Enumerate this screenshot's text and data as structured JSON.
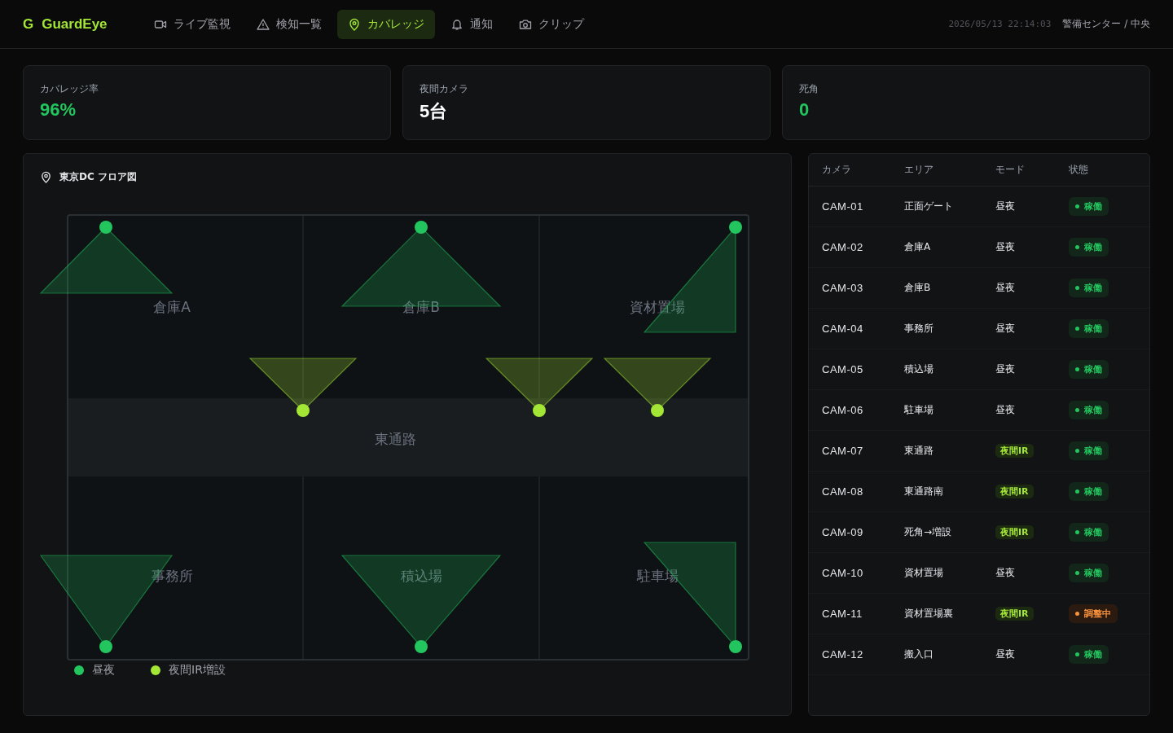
{
  "brand": {
    "mark": "G",
    "name": "GuardEye"
  },
  "nav": [
    {
      "label": "ライブ監視",
      "selected": false
    },
    {
      "label": "検知一覧",
      "selected": false
    },
    {
      "label": "カバレッジ",
      "selected": true
    },
    {
      "label": "通知",
      "selected": false
    },
    {
      "label": "クリップ",
      "selected": false
    }
  ],
  "datetime": "2026/05/13 22:14:03",
  "location": "警備センター / 中央",
  "kpis": [
    {
      "label": "カバレッジ率",
      "value": "96%",
      "kind": "accent"
    },
    {
      "label": "夜間カメラ",
      "value": "5台",
      "kind": "plain"
    },
    {
      "label": "死角",
      "value": "0",
      "kind": "accent"
    }
  ],
  "map": {
    "title": "東京DC フロア図",
    "zones": [
      "倉庫A",
      "倉庫B",
      "資材置場",
      "東通路",
      "事務所",
      "積込場",
      "駐車場"
    ],
    "cameras": [
      {
        "kind": "day"
      },
      {
        "kind": "day"
      },
      {
        "kind": "day"
      },
      {
        "kind": "ir"
      },
      {
        "kind": "ir"
      },
      {
        "kind": "ir"
      },
      {
        "kind": "day"
      },
      {
        "kind": "day"
      },
      {
        "kind": "day"
      }
    ],
    "legend": [
      {
        "label": "昼夜",
        "kind": "day",
        "color": "#22c55e"
      },
      {
        "label": "夜間IR増設",
        "kind": "ir",
        "color": "#a3e635"
      }
    ]
  },
  "table": {
    "columns": [
      "カメラ",
      "エリア",
      "モード",
      "状態"
    ],
    "rows": [
      {
        "camera": "CAM-01",
        "area": "正面ゲート",
        "mode": {
          "text": "昼夜",
          "kind": "day"
        },
        "status": {
          "text": "稼働",
          "kind": "ok"
        }
      },
      {
        "camera": "CAM-02",
        "area": "倉庫A",
        "mode": {
          "text": "昼夜",
          "kind": "day"
        },
        "status": {
          "text": "稼働",
          "kind": "ok"
        }
      },
      {
        "camera": "CAM-03",
        "area": "倉庫B",
        "mode": {
          "text": "昼夜",
          "kind": "day"
        },
        "status": {
          "text": "稼働",
          "kind": "ok"
        }
      },
      {
        "camera": "CAM-04",
        "area": "事務所",
        "mode": {
          "text": "昼夜",
          "kind": "day"
        },
        "status": {
          "text": "稼働",
          "kind": "ok"
        }
      },
      {
        "camera": "CAM-05",
        "area": "積込場",
        "mode": {
          "text": "昼夜",
          "kind": "day"
        },
        "status": {
          "text": "稼働",
          "kind": "ok"
        }
      },
      {
        "camera": "CAM-06",
        "area": "駐車場",
        "mode": {
          "text": "昼夜",
          "kind": "day"
        },
        "status": {
          "text": "稼働",
          "kind": "ok"
        }
      },
      {
        "camera": "CAM-07",
        "area": "東通路",
        "mode": {
          "text": "夜間IR",
          "kind": "ir"
        },
        "status": {
          "text": "稼働",
          "kind": "ok"
        }
      },
      {
        "camera": "CAM-08",
        "area": "東通路南",
        "mode": {
          "text": "夜間IR",
          "kind": "ir"
        },
        "status": {
          "text": "稼働",
          "kind": "ok"
        }
      },
      {
        "camera": "CAM-09",
        "area": "死角→増設",
        "mode": {
          "text": "夜間IR",
          "kind": "ir"
        },
        "status": {
          "text": "稼働",
          "kind": "ok"
        }
      },
      {
        "camera": "CAM-10",
        "area": "資材置場",
        "mode": {
          "text": "昼夜",
          "kind": "day"
        },
        "status": {
          "text": "稼働",
          "kind": "ok"
        }
      },
      {
        "camera": "CAM-11",
        "area": "資材置場裏",
        "mode": {
          "text": "夜間IR",
          "kind": "ir"
        },
        "status": {
          "text": "調整中",
          "kind": "warn"
        }
      },
      {
        "camera": "CAM-12",
        "area": "搬入口",
        "mode": {
          "text": "昼夜",
          "kind": "day"
        },
        "status": {
          "text": "稼働",
          "kind": "ok"
        }
      }
    ]
  }
}
